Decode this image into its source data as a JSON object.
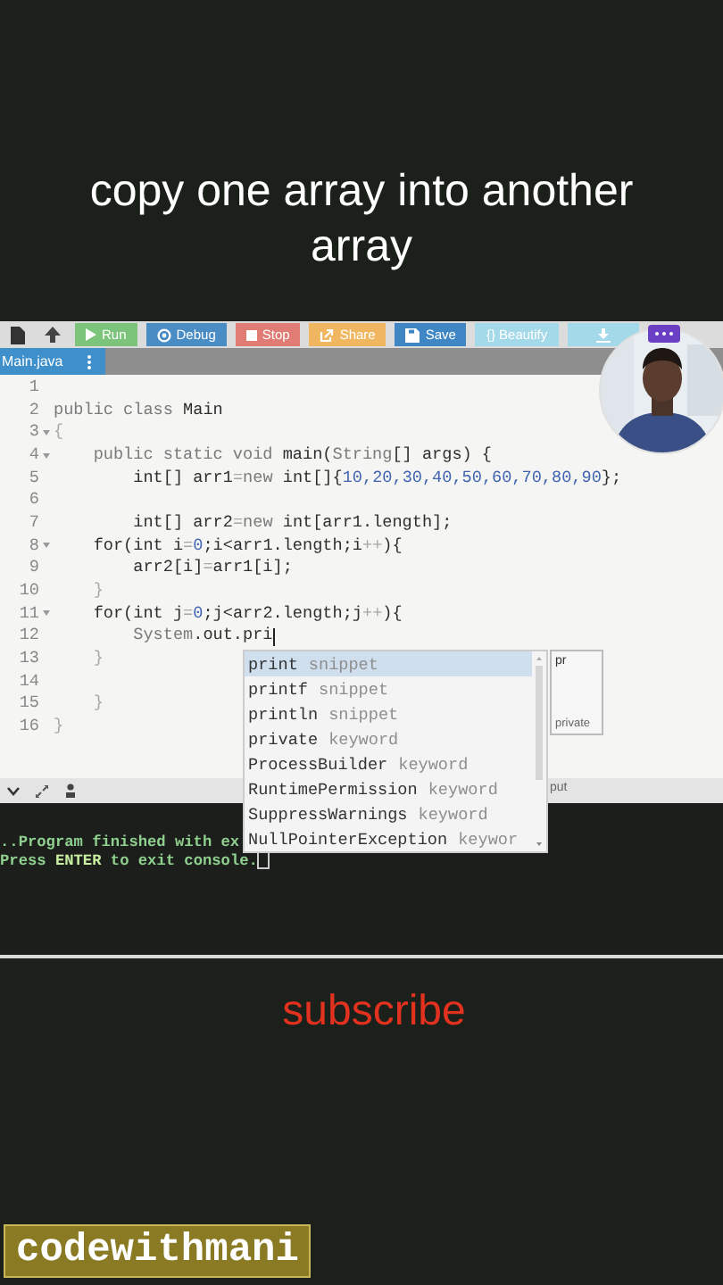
{
  "video_title": "copy one array into another array",
  "toolbar": {
    "buttons": [
      {
        "kind": "file"
      },
      {
        "kind": "upload"
      },
      {
        "kind": "run",
        "label": "Run"
      },
      {
        "kind": "debug",
        "label": "Debug"
      },
      {
        "kind": "stop",
        "label": "Stop"
      },
      {
        "kind": "share",
        "label": "Share"
      },
      {
        "kind": "save",
        "label": "Save"
      },
      {
        "kind": "beautify",
        "label": "{} Beautify"
      },
      {
        "kind": "download"
      }
    ]
  },
  "file_tab": {
    "label": "Main.java",
    "selected": true
  },
  "code_lines": [
    {
      "number": "1",
      "fold": false,
      "cursor": false
    },
    {
      "number": "2",
      "fold": false,
      "cursor": false,
      "tokens": [
        {
          "kind": "kw",
          "text": "public class "
        },
        {
          "kind": "plain",
          "text": "Main"
        }
      ]
    },
    {
      "number": "3",
      "fold": true,
      "cursor": false,
      "tokens": [
        {
          "kind": "op",
          "text": "{"
        }
      ]
    },
    {
      "number": "4",
      "fold": true,
      "cursor": false,
      "tokens": [
        {
          "kind": "kw",
          "text": "    public static void "
        },
        {
          "kind": "plain",
          "text": "main("
        },
        {
          "kind": "kw",
          "text": "String"
        },
        {
          "kind": "plain",
          "text": "[] args) {"
        }
      ]
    },
    {
      "number": "5",
      "fold": false,
      "cursor": false,
      "tokens": [
        {
          "kind": "plain",
          "text": "        int[] arr1"
        },
        {
          "kind": "op",
          "text": "="
        },
        {
          "kind": "kw",
          "text": "new "
        },
        {
          "kind": "plain",
          "text": "int[]{"
        },
        {
          "kind": "num",
          "text": "10,20,30,40,50,60,70,80,90"
        },
        {
          "kind": "plain",
          "text": "};"
        }
      ]
    },
    {
      "number": "6",
      "fold": false,
      "cursor": false
    },
    {
      "number": "7",
      "fold": false,
      "cursor": false,
      "tokens": [
        {
          "kind": "plain",
          "text": "        int[] arr2"
        },
        {
          "kind": "op",
          "text": "="
        },
        {
          "kind": "kw",
          "text": "new "
        },
        {
          "kind": "plain",
          "text": "int[arr1.length];"
        }
      ]
    },
    {
      "number": "8",
      "fold": true,
      "cursor": false,
      "tokens": [
        {
          "kind": "plain",
          "text": "    for(int i"
        },
        {
          "kind": "op",
          "text": "="
        },
        {
          "kind": "num",
          "text": "0"
        },
        {
          "kind": "plain",
          "text": ";i<arr1.length;i"
        },
        {
          "kind": "op",
          "text": "++"
        },
        {
          "kind": "plain",
          "text": "){"
        }
      ]
    },
    {
      "number": "9",
      "fold": false,
      "cursor": false,
      "tokens": [
        {
          "kind": "plain",
          "text": "        arr2[i]"
        },
        {
          "kind": "op",
          "text": "="
        },
        {
          "kind": "plain",
          "text": "arr1[i];"
        }
      ]
    },
    {
      "number": "10",
      "fold": false,
      "cursor": false,
      "tokens": [
        {
          "kind": "op",
          "text": "    }"
        }
      ]
    },
    {
      "number": "11",
      "fold": true,
      "cursor": false,
      "tokens": [
        {
          "kind": "plain",
          "text": "    for(int j"
        },
        {
          "kind": "op",
          "text": "="
        },
        {
          "kind": "num",
          "text": "0"
        },
        {
          "kind": "plain",
          "text": ";j<arr2.length;j"
        },
        {
          "kind": "op",
          "text": "++"
        },
        {
          "kind": "plain",
          "text": "){"
        }
      ]
    },
    {
      "number": "12",
      "fold": false,
      "cursor": true,
      "tokens": [
        {
          "kind": "kw",
          "text": "        System"
        },
        {
          "kind": "plain",
          "text": ".out.pri"
        }
      ]
    },
    {
      "number": "13",
      "fold": false,
      "cursor": false,
      "tokens": [
        {
          "kind": "op",
          "text": "    }"
        }
      ]
    },
    {
      "number": "14",
      "fold": false,
      "cursor": false
    },
    {
      "number": "15",
      "fold": false,
      "cursor": false,
      "tokens": [
        {
          "kind": "op",
          "text": "    }"
        }
      ]
    },
    {
      "number": "16",
      "fold": false,
      "cursor": false,
      "tokens": [
        {
          "kind": "op",
          "text": "}"
        }
      ]
    }
  ],
  "autocomplete": {
    "items": [
      {
        "label": "print",
        "type": "snippet",
        "selected": true
      },
      {
        "label": "printf",
        "type": "snippet",
        "selected": false
      },
      {
        "label": "println",
        "type": "snippet",
        "selected": false
      },
      {
        "label": "private",
        "type": "keyword",
        "selected": false
      },
      {
        "label": "ProcessBuilder",
        "type": "keyword",
        "selected": false
      },
      {
        "label": "RuntimePermission",
        "type": "keyword",
        "selected": false
      },
      {
        "label": "SuppressWarnings",
        "type": "keyword",
        "selected": false
      },
      {
        "label": "NullPointerException",
        "type": "keywor",
        "selected": false
      }
    ],
    "doc": {
      "title": "pr",
      "body": "private"
    }
  },
  "bottom_bar": {
    "tab_label": "put"
  },
  "console": {
    "lines": [
      "..Program finished with ex",
      "Press **ENTER** to exit console."
    ]
  },
  "subscribe": "subscribe",
  "channel": "codewithmani"
}
